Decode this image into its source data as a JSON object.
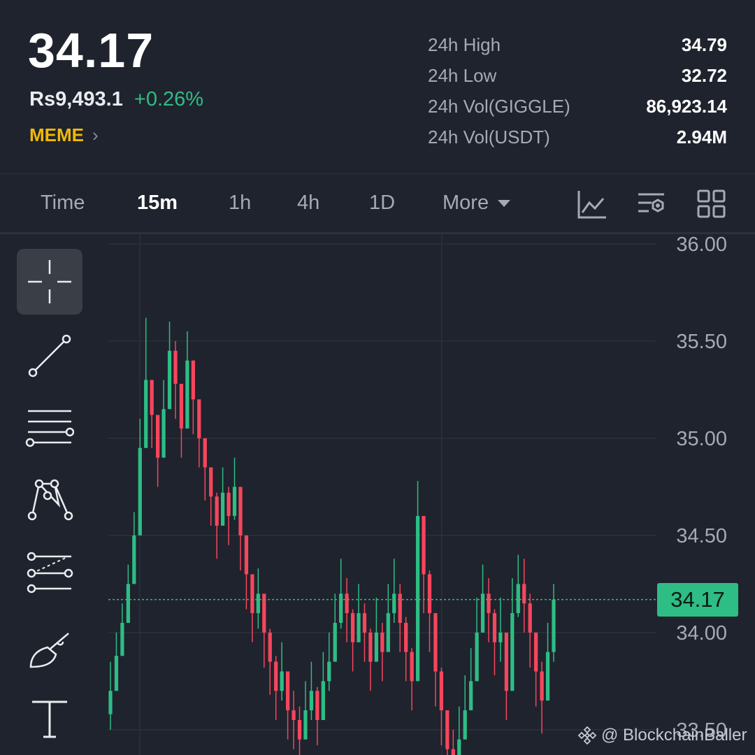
{
  "header": {
    "last_price": "34.17",
    "fiat_price": "Rs9,493.1",
    "change_pct": "+0.26%",
    "tag": "MEME",
    "tag_chevron": "›",
    "stats": [
      {
        "label": "24h High",
        "value": "34.79"
      },
      {
        "label": "24h Low",
        "value": "32.72"
      },
      {
        "label": "24h Vol(GIGGLE)",
        "value": "86,923.14"
      },
      {
        "label": "24h Vol(USDT)",
        "value": "2.94M"
      }
    ]
  },
  "toolbar": {
    "time_label": "Time",
    "intervals": [
      "15m",
      "1h",
      "4h",
      "1D"
    ],
    "active_interval": "15m",
    "more_label": "More",
    "icons": [
      "indicator-chart-icon",
      "settings-filter-icon",
      "layout-grid-icon"
    ]
  },
  "drawing_tools": [
    "crosshair-icon",
    "trend-line-icon",
    "horizontal-lines-icon",
    "pattern-icon",
    "fib-channel-icon",
    "brush-icon",
    "text-tool-icon"
  ],
  "chart_data": {
    "type": "candlestick",
    "ylim": [
      33.37,
      36.05
    ],
    "y_ticks": [
      "36.00",
      "35.50",
      "35.00",
      "34.50",
      "34.00",
      "33.50"
    ],
    "current_price": "34.17",
    "up_color": "#2ebd85",
    "down_color": "#f6465d",
    "closes": [
      33.7,
      33.88,
      34.05,
      34.25,
      34.5,
      34.95,
      35.3,
      35.12,
      34.9,
      35.15,
      35.45,
      35.28,
      35.05,
      35.4,
      35.2,
      35.0,
      34.85,
      34.7,
      34.55,
      34.72,
      34.6,
      34.75,
      34.5,
      34.3,
      34.1,
      34.2,
      34.0,
      33.85,
      33.7,
      33.8,
      33.6,
      33.55,
      33.45,
      33.6,
      33.7,
      33.55,
      33.75,
      33.85,
      34.05,
      34.2,
      34.1,
      33.95,
      34.1,
      34.0,
      33.85,
      34.0,
      33.9,
      34.1,
      34.2,
      34.05,
      33.9,
      33.75,
      34.6,
      34.3,
      34.1,
      33.8,
      33.6,
      33.4,
      33.3,
      33.45,
      33.6,
      33.75,
      34.0,
      34.2,
      34.1,
      33.95,
      34.0,
      33.7,
      34.1,
      34.25,
      34.15,
      34.0,
      33.8,
      33.65,
      33.9,
      34.17
    ],
    "highs": [
      33.85,
      34.0,
      34.15,
      34.35,
      34.62,
      35.1,
      35.62,
      35.3,
      35.1,
      35.3,
      35.6,
      35.5,
      35.25,
      35.55,
      35.4,
      35.15,
      35.0,
      34.85,
      34.72,
      34.85,
      34.75,
      34.9,
      34.68,
      34.5,
      34.28,
      34.33,
      34.18,
      34.02,
      33.88,
      33.95,
      33.8,
      33.7,
      33.62,
      33.75,
      33.85,
      33.72,
      33.9,
      34.0,
      34.2,
      34.38,
      34.28,
      34.12,
      34.25,
      34.15,
      34.02,
      34.18,
      34.05,
      34.25,
      34.38,
      34.25,
      34.08,
      33.92,
      34.78,
      34.58,
      34.32,
      34.0,
      33.82,
      33.6,
      33.5,
      33.62,
      33.78,
      33.92,
      34.18,
      34.35,
      34.28,
      34.12,
      34.18,
      33.9,
      34.28,
      34.4,
      34.38,
      34.2,
      34.0,
      33.85,
      34.05,
      34.25
    ],
    "lows": [
      33.5,
      33.7,
      33.9,
      34.1,
      34.35,
      34.8,
      35.05,
      34.95,
      34.75,
      34.95,
      35.25,
      35.1,
      34.9,
      35.2,
      35.02,
      34.85,
      34.68,
      34.55,
      34.38,
      34.55,
      34.45,
      34.58,
      34.32,
      34.12,
      33.95,
      34.02,
      33.82,
      33.68,
      33.55,
      33.65,
      33.45,
      33.4,
      33.35,
      33.45,
      33.55,
      33.42,
      33.6,
      33.7,
      33.88,
      34.02,
      33.95,
      33.8,
      33.95,
      33.85,
      33.7,
      33.85,
      33.75,
      33.95,
      34.05,
      33.9,
      33.75,
      33.6,
      33.85,
      34.1,
      33.9,
      33.62,
      33.42,
      33.3,
      33.2,
      33.3,
      33.45,
      33.6,
      33.85,
      34.0,
      33.95,
      33.78,
      33.85,
      33.55,
      33.9,
      34.08,
      34.0,
      33.82,
      33.62,
      33.48,
      33.7,
      33.85
    ]
  },
  "watermark": "@ BlockchainBaller"
}
